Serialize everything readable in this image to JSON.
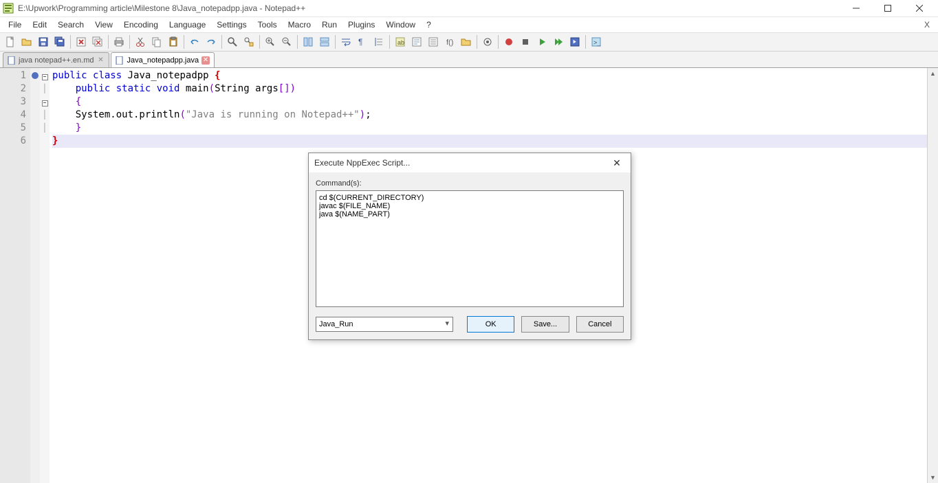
{
  "window": {
    "title": "E:\\Upwork\\Programming article\\Milestone 8\\Java_notepadpp.java - Notepad++"
  },
  "menu": {
    "items": [
      "File",
      "Edit",
      "Search",
      "View",
      "Encoding",
      "Language",
      "Settings",
      "Tools",
      "Macro",
      "Run",
      "Plugins",
      "Window",
      "?"
    ]
  },
  "tabs": [
    {
      "label": "java notepad++.en.md",
      "active": false
    },
    {
      "label": "Java_notepadpp.java",
      "active": true
    }
  ],
  "code": {
    "lines": [
      {
        "n": 1,
        "html": "<span class='kw'>public</span> <span class='kw'>class</span> Java_notepadpp <span class='br1'>{</span>"
      },
      {
        "n": 2,
        "html": "    <span class='kw'>public</span> <span class='kw'>static</span> <span class='kw'>void</span> main<span class='br2'>(</span>String args<span class='br2'>[]</span><span class='br2'>)</span>"
      },
      {
        "n": 3,
        "html": "    <span class='br2'>{</span>"
      },
      {
        "n": 4,
        "html": "    System.out.println<span class='br2'>(</span><span class='str'>\"Java is running on Notepad++\"</span><span class='br2'>)</span>;"
      },
      {
        "n": 5,
        "html": "    <span class='br2'>}</span>"
      },
      {
        "n": 6,
        "html": "<span class='br1'>}</span>"
      }
    ]
  },
  "dialog": {
    "title": "Execute NppExec Script...",
    "commands_label": "Command(s):",
    "commands_text": "cd $(CURRENT_DIRECTORY)\njavac $(FILE_NAME)\njava $(NAME_PART)",
    "script_name": "Java_Run",
    "ok": "OK",
    "save": "Save...",
    "cancel": "Cancel"
  }
}
